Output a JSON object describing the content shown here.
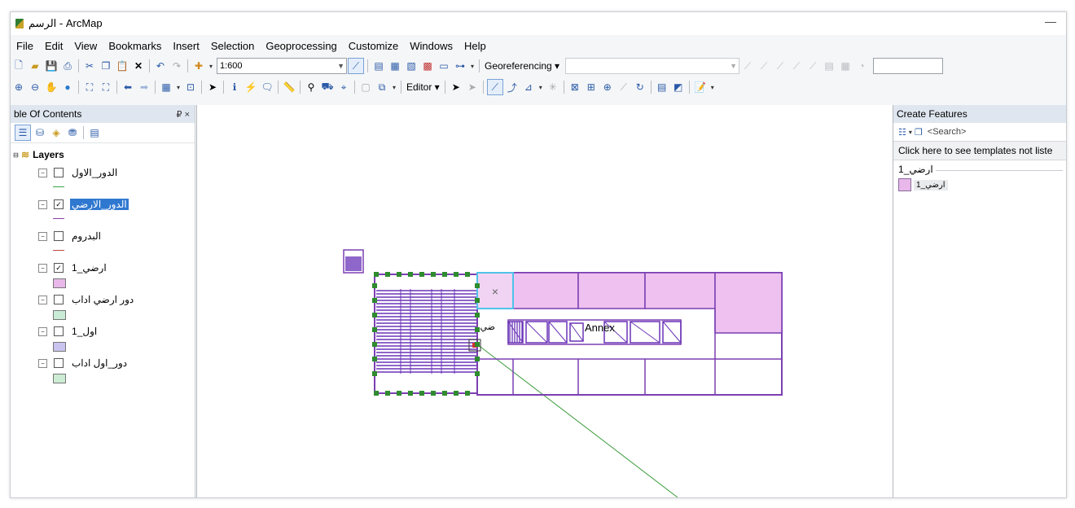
{
  "window": {
    "title": "الرسم - ArcMap",
    "minimize_glyph": "—"
  },
  "menu": [
    "File",
    "Edit",
    "View",
    "Bookmarks",
    "Insert",
    "Selection",
    "Geoprocessing",
    "Customize",
    "Windows",
    "Help"
  ],
  "toolbar": {
    "scale_value": "1:600",
    "georeferencing_label": "Georeferencing ▾",
    "editor_label": "Editor ▾"
  },
  "toc": {
    "title": "ble Of Contents",
    "controls": "₽ ×",
    "root_label": "Layers",
    "layers": [
      {
        "name": "الدور_الاول",
        "checked": false,
        "selected": false,
        "swatch": "line",
        "color": "#39a845"
      },
      {
        "name": "الدور_الارضي",
        "checked": true,
        "selected": true,
        "swatch": "line",
        "color": "#8a3fa8"
      },
      {
        "name": "البدروم",
        "checked": false,
        "selected": false,
        "swatch": "line",
        "color": "#c04848"
      },
      {
        "name": "ارضي_1",
        "checked": true,
        "selected": false,
        "swatch": "fill",
        "color": "#e8b8ea"
      },
      {
        "name": "دور ارضي اداب",
        "checked": false,
        "selected": false,
        "swatch": "fill",
        "color": "#c9ecd6"
      },
      {
        "name": "اول_1",
        "checked": false,
        "selected": false,
        "swatch": "fill",
        "color": "#c8c4ee"
      },
      {
        "name": "دور_اول اداب",
        "checked": false,
        "selected": false,
        "swatch": "fill",
        "color": "#ccecd3"
      }
    ]
  },
  "map": {
    "annotation_text": "Annex",
    "arabic_label": "ضي",
    "colors": {
      "outline": "#7b3fb2",
      "fill": "#eec1f0",
      "hatch": "#6a34b8",
      "vertex": "#2e8b2e",
      "selection": "#4fc3e8",
      "line": "#3a9a3a"
    }
  },
  "create_features": {
    "title": "Create Features",
    "search_placeholder": "<Search>",
    "message": "Click here to see templates not liste",
    "group_label": "ارضي_1",
    "template_label": "ارضي_1"
  }
}
